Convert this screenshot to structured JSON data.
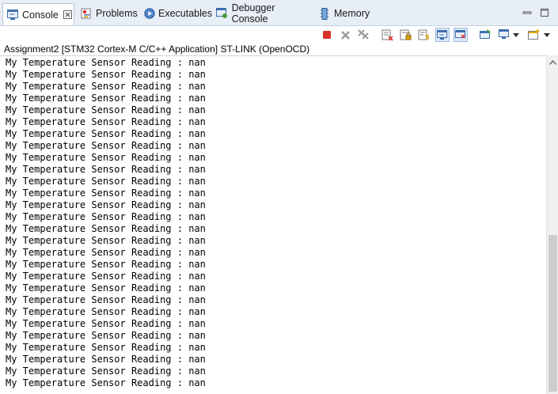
{
  "tabs": [
    {
      "label": "Console",
      "icon": "console-icon",
      "active": true
    },
    {
      "label": "Problems",
      "icon": "problems-icon"
    },
    {
      "label": "Executables",
      "icon": "executables-icon"
    },
    {
      "label": "Debugger Console",
      "icon": "debugger-console-icon"
    },
    {
      "label": "Memory",
      "icon": "memory-icon"
    }
  ],
  "launch_label": "Assignment2 [STM32 Cortex-M C/C++ Application] ST-LINK (OpenOCD)",
  "console_line": "My Temperature Sensor Reading : nan",
  "console_line_count": 28,
  "colors": {
    "terminate": "#d9302c",
    "accent": "#3d6fb0"
  },
  "toolbar_icons": [
    "terminate-icon",
    "remove-launch-icon",
    "remove-all-terminated-icon",
    "clear-console-icon",
    "scroll-lock-icon",
    "word-wrap-icon",
    "show-on-stdout-icon",
    "show-on-stderr-icon",
    "pin-console-icon",
    "display-console-icon",
    "new-console-icon"
  ]
}
